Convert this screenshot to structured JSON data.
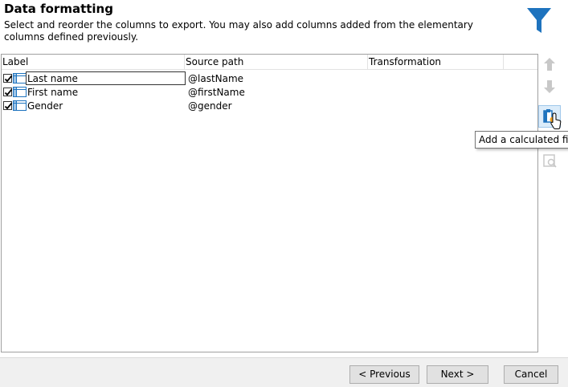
{
  "header": {
    "title": "Data formatting",
    "subtitle": "Select and reorder the columns to export. You may also add columns added from the elementary columns defined previously."
  },
  "grid": {
    "columns": [
      "Label",
      "Source path",
      "Transformation"
    ],
    "rows": [
      {
        "label": "Last name",
        "source": "@lastName",
        "checked": true
      },
      {
        "label": "First name",
        "source": "@firstName",
        "checked": true
      },
      {
        "label": "Gender",
        "source": "@gender",
        "checked": true
      }
    ]
  },
  "toolbar": {
    "tooltip": "Add a calculated field",
    "icons": [
      "move-up-icon",
      "move-down-icon",
      "add-calculated-field-icon",
      "preview-icon"
    ]
  },
  "footer": {
    "previous_label": "< Previous",
    "next_label": "Next >",
    "cancel_label": "Cancel"
  },
  "colors": {
    "accent": "#1e73be",
    "tooltip_border": "#767676",
    "footer_bg": "#f0f0f0"
  }
}
